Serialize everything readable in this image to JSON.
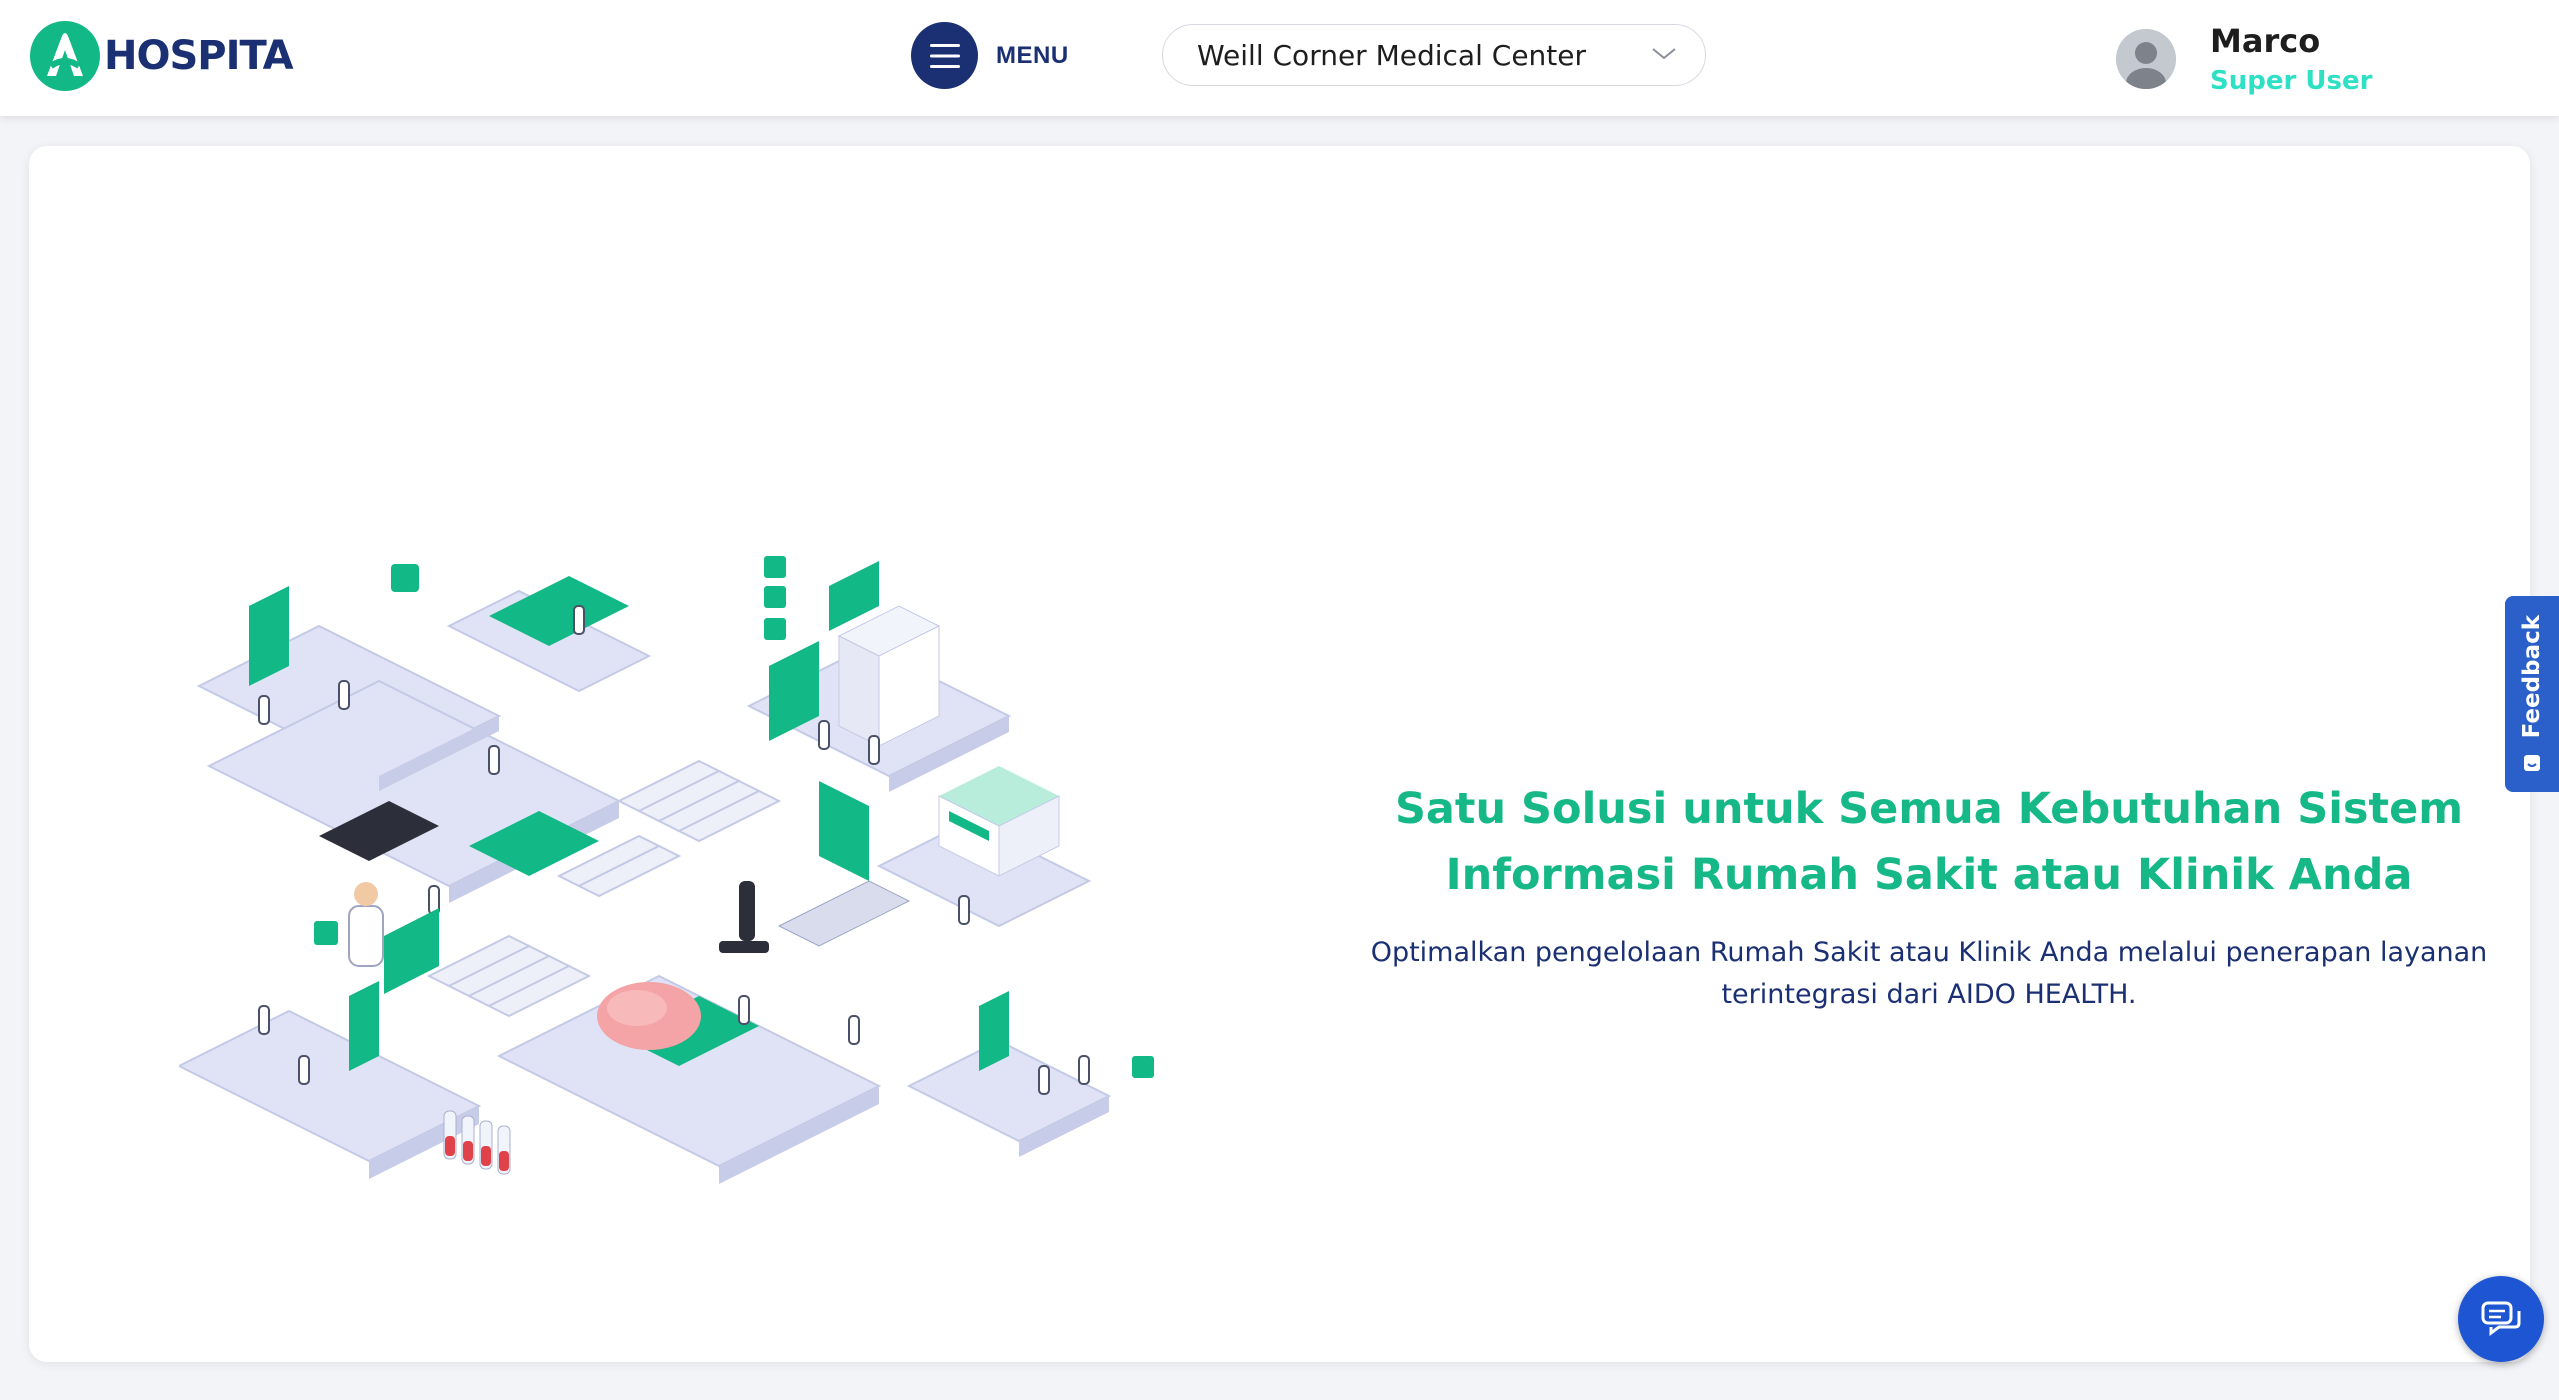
{
  "header": {
    "logo_text": "HOSPITA",
    "menu_label": "MENU",
    "facility_select": {
      "value": "Weill Corner Medical Center"
    },
    "user": {
      "name": "Marco",
      "role": "Super User"
    }
  },
  "main": {
    "headline_line1": "Satu Solusi untuk Semua Kebutuhan Sistem",
    "headline_line2": "Informasi Rumah Sakit atau Klinik Anda",
    "subtext_line1": "Optimalkan pengelolaan Rumah Sakit atau Klinik Anda melalui penerapan layanan",
    "subtext_line2": "terintegrasi dari AIDO HEALTH."
  },
  "feedback": {
    "label": "Feedback"
  },
  "colors": {
    "brand_navy": "#1b2f73",
    "brand_green": "#15b886",
    "role_cyan": "#2ee0c4",
    "feedback_blue": "#2b5fc9"
  },
  "icons": [
    "logo-mark-icon",
    "hamburger-icon",
    "chevron-down-icon",
    "user-avatar-icon",
    "feedback-icon",
    "chat-icon"
  ]
}
